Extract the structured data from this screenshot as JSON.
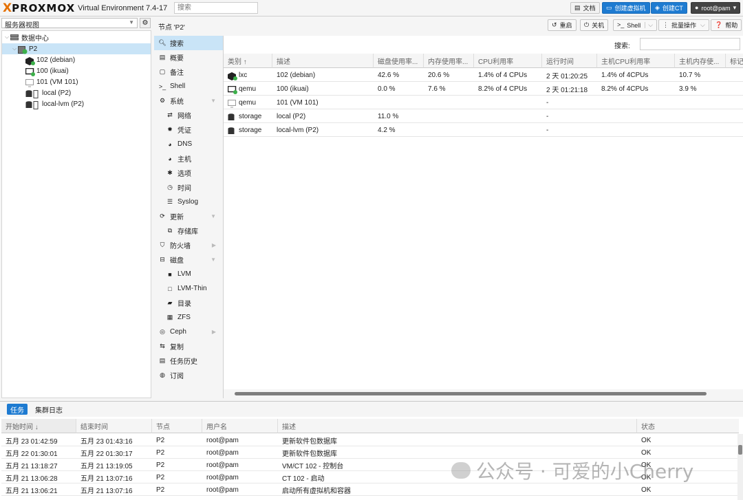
{
  "app": {
    "brand_x": "X",
    "brand": "PROXMOX",
    "version": "Virtual Environment 7.4-17",
    "search_placeholder": "搜索"
  },
  "topbar": {
    "docs": "文档",
    "create_vm": "创建虚拟机",
    "create_ct": "创建CT",
    "user": "root@pam"
  },
  "sidebar": {
    "view_select": "服务器视图",
    "tree": [
      {
        "label": "数据中心",
        "type": "datacenter"
      },
      {
        "label": "P2",
        "type": "node",
        "selected": true
      },
      {
        "label": "102 (debian)",
        "type": "lxc-running"
      },
      {
        "label": "100 (ikuai)",
        "type": "qemu-running"
      },
      {
        "label": "101 (VM 101)",
        "type": "qemu-stopped"
      },
      {
        "label": "local (P2)",
        "type": "storage"
      },
      {
        "label": "local-lvm (P2)",
        "type": "storage"
      }
    ]
  },
  "node_header": {
    "title": "节点 'P2'",
    "reboot": "重启",
    "shutdown": "关机",
    "shell": "Shell",
    "bulk": "批量操作",
    "help": "帮助"
  },
  "menu": [
    {
      "label": "搜索",
      "icon": "search-icon",
      "selected": true
    },
    {
      "label": "概要",
      "icon": "book-icon"
    },
    {
      "label": "备注",
      "icon": "notes-icon"
    },
    {
      "label": "Shell",
      "icon": "terminal-icon"
    },
    {
      "label": "系统",
      "icon": "gears-icon",
      "expander": "collapse"
    },
    {
      "label": "网络",
      "icon": "network-icon",
      "sub": true
    },
    {
      "label": "凭证",
      "icon": "certificate-icon",
      "sub": true
    },
    {
      "label": "DNS",
      "icon": "globe-icon",
      "sub": true
    },
    {
      "label": "主机",
      "icon": "globe-icon",
      "sub": true
    },
    {
      "label": "选项",
      "icon": "gear-icon",
      "sub": true
    },
    {
      "label": "时间",
      "icon": "clock-icon",
      "sub": true
    },
    {
      "label": "Syslog",
      "icon": "list-icon",
      "sub": true
    },
    {
      "label": "更新",
      "icon": "refresh-icon",
      "expander": "collapse"
    },
    {
      "label": "存储库",
      "icon": "files-icon",
      "sub": true
    },
    {
      "label": "防火墙",
      "icon": "shield-icon",
      "expander": "expand"
    },
    {
      "label": "磁盘",
      "icon": "hdd-icon",
      "expander": "collapse"
    },
    {
      "label": "LVM",
      "icon": "square-icon",
      "sub": true
    },
    {
      "label": "LVM-Thin",
      "icon": "square-outline-icon",
      "sub": true
    },
    {
      "label": "目录",
      "icon": "folder-icon",
      "sub": true
    },
    {
      "label": "ZFS",
      "icon": "th-icon",
      "sub": true
    },
    {
      "label": "Ceph",
      "icon": "ceph-icon",
      "expander": "expand"
    },
    {
      "label": "复制",
      "icon": "retweet-icon"
    },
    {
      "label": "任务历史",
      "icon": "list-alt-icon"
    },
    {
      "label": "订阅",
      "icon": "support-icon"
    }
  ],
  "search_label": "搜索:",
  "resources": {
    "columns": [
      "类别 ↑",
      "描述",
      "磁盘使用率...",
      "内存使用率...",
      "CPU利用率",
      "运行时间",
      "主机CPU利用率",
      "主机内存使...",
      "标记"
    ],
    "rows": [
      {
        "icon": "lxc",
        "type": "lxc",
        "desc": "102 (debian)",
        "disk": "42.6 %",
        "mem": "20.6 %",
        "cpu": "1.4% of 4 CPUs",
        "uptime": "2 天 01:20:25",
        "hostcpu": "1.4% of 4CPUs",
        "hostmem": "10.7 %"
      },
      {
        "icon": "qemu",
        "type": "qemu",
        "desc": "100 (ikuai)",
        "disk": "0.0 %",
        "mem": "7.6 %",
        "cpu": "8.2% of 4 CPUs",
        "uptime": "2 天 01:21:18",
        "hostcpu": "8.2% of 4CPUs",
        "hostmem": "3.9 %"
      },
      {
        "icon": "qemu-off",
        "type": "qemu",
        "desc": "101 (VM 101)",
        "disk": "",
        "mem": "",
        "cpu": "",
        "uptime": "-",
        "hostcpu": "",
        "hostmem": ""
      },
      {
        "icon": "storage",
        "type": "storage",
        "desc": "local (P2)",
        "disk": "11.0 %",
        "mem": "",
        "cpu": "",
        "uptime": "-",
        "hostcpu": "",
        "hostmem": ""
      },
      {
        "icon": "storage",
        "type": "storage",
        "desc": "local-lvm (P2)",
        "disk": "4.2 %",
        "mem": "",
        "cpu": "",
        "uptime": "-",
        "hostcpu": "",
        "hostmem": ""
      }
    ]
  },
  "bottom": {
    "tab_tasks": "任务",
    "tab_cluster_log": "集群日志",
    "columns": [
      "开始时间 ↓",
      "结束时间",
      "节点",
      "用户名",
      "描述",
      "状态"
    ],
    "rows": [
      [
        "五月 23 01:42:59",
        "五月 23 01:43:16",
        "P2",
        "root@pam",
        "更新软件包数据库",
        "OK"
      ],
      [
        "五月 22 01:30:01",
        "五月 22 01:30:17",
        "P2",
        "root@pam",
        "更新软件包数据库",
        "OK"
      ],
      [
        "五月 21 13:18:27",
        "五月 21 13:19:05",
        "P2",
        "root@pam",
        "VM/CT 102 - 控制台",
        "OK"
      ],
      [
        "五月 21 13:06:28",
        "五月 21 13:07:16",
        "P2",
        "root@pam",
        "CT 102 - 启动",
        "OK"
      ],
      [
        "五月 21 13:06:21",
        "五月 21 13:07:16",
        "P2",
        "root@pam",
        "启动所有虚拟机和容器",
        "OK"
      ]
    ]
  },
  "watermark": "公众号 · 可爱的小Cherry",
  "colors": {
    "accent": "#1e7bd1",
    "brand_orange": "#e57000",
    "selection": "#c9e4f7",
    "running_green": "#3cb04a"
  }
}
